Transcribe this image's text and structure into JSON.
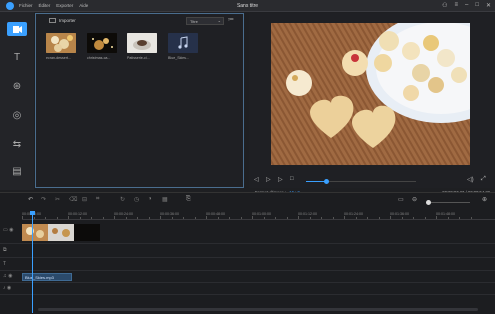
{
  "window": {
    "title": "Sans titre",
    "menu": [
      "Fichier",
      "Éditer",
      "Exporter",
      "Aide"
    ]
  },
  "library": {
    "import_label": "Importer",
    "sort_value": "Titre",
    "items": [
      {
        "label": "ecran-dessert..."
      },
      {
        "label": "christmas-ca..."
      },
      {
        "label": "Patisserie-ci..."
      },
      {
        "label": "Blue_Skies..."
      }
    ]
  },
  "preview": {
    "format_label": "Format d'image :",
    "format_value": "16 : 9",
    "timecode": "00:00:07.23 / 00:00:54.38",
    "progress": 0.18
  },
  "timeline": {
    "ruler_ticks": [
      "00:00:00:00",
      "00:00:12:00",
      "00:00:24:00",
      "00:00:36:00",
      "00:00:48:00",
      "00:01:00:00",
      "00:01:12:00",
      "00:01:24:00",
      "00:01:36:00",
      "00:01:48:00"
    ],
    "audio_clip_label": "Blue_Skies.mp3",
    "zoom": 0.05
  },
  "colors": {
    "accent": "#3aa0ff"
  }
}
